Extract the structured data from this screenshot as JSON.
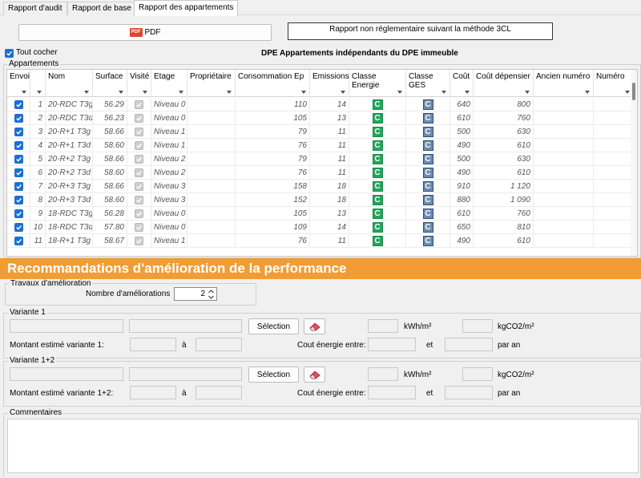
{
  "tabs": [
    {
      "label": "Rapport d'audit",
      "active": false
    },
    {
      "label": "Rapport de base",
      "active": false
    },
    {
      "label": "Rapport des appartements",
      "active": true
    }
  ],
  "toolbar": {
    "pdf_icon_text": "PDF",
    "pdf_label": "PDF",
    "report_button_label": "Rapport non réglementaire suivant la méthode 3CL"
  },
  "select_all_label": "Tout cocher",
  "select_all_checked": true,
  "section_title": "DPE Appartements indépendants du DPE immeuble",
  "table": {
    "group_label": "Appartements",
    "columns": [
      "Envoi",
      "",
      "Nom",
      "Surface",
      "Visité",
      "Etage",
      "Propriétaire",
      "Consommation Ep",
      "Emissions",
      "Classe Energie",
      "Classe GES",
      "Coût",
      "Coût dépensier",
      "Ancien numéro",
      "Numéro"
    ],
    "rows": [
      {
        "envoi": true,
        "num": "1",
        "nom": "20-RDC T3g",
        "surface": "56.29",
        "visite": true,
        "etage": "Niveau 0",
        "proprietaire": "",
        "conso": "110",
        "emissions": "14",
        "classe_energie": "C",
        "classe_ges": "C",
        "cout": "640",
        "cout_dep": "800",
        "ancien": "",
        "numero": ""
      },
      {
        "envoi": true,
        "num": "2",
        "nom": "20-RDC T3d",
        "surface": "56.23",
        "visite": true,
        "etage": "Niveau 0",
        "proprietaire": "",
        "conso": "105",
        "emissions": "13",
        "classe_energie": "C",
        "classe_ges": "C",
        "cout": "610",
        "cout_dep": "760",
        "ancien": "",
        "numero": ""
      },
      {
        "envoi": true,
        "num": "3",
        "nom": "20-R+1 T3g",
        "surface": "58.66",
        "visite": true,
        "etage": "Niveau 1",
        "proprietaire": "",
        "conso": "79",
        "emissions": "11",
        "classe_energie": "C",
        "classe_ges": "C",
        "cout": "500",
        "cout_dep": "630",
        "ancien": "",
        "numero": ""
      },
      {
        "envoi": true,
        "num": "4",
        "nom": "20-R+1 T3d",
        "surface": "58.60",
        "visite": true,
        "etage": "Niveau 1",
        "proprietaire": "",
        "conso": "76",
        "emissions": "11",
        "classe_energie": "C",
        "classe_ges": "C",
        "cout": "490",
        "cout_dep": "610",
        "ancien": "",
        "numero": ""
      },
      {
        "envoi": true,
        "num": "5",
        "nom": "20-R+2 T3g",
        "surface": "58.66",
        "visite": true,
        "etage": "Niveau 2",
        "proprietaire": "",
        "conso": "79",
        "emissions": "11",
        "classe_energie": "C",
        "classe_ges": "C",
        "cout": "500",
        "cout_dep": "630",
        "ancien": "",
        "numero": ""
      },
      {
        "envoi": true,
        "num": "6",
        "nom": "20-R+2 T3d",
        "surface": "58.60",
        "visite": true,
        "etage": "Niveau 2",
        "proprietaire": "",
        "conso": "76",
        "emissions": "11",
        "classe_energie": "C",
        "classe_ges": "C",
        "cout": "490",
        "cout_dep": "610",
        "ancien": "",
        "numero": ""
      },
      {
        "envoi": true,
        "num": "7",
        "nom": "20-R+3 T3g",
        "surface": "58.66",
        "visite": true,
        "etage": "Niveau 3",
        "proprietaire": "",
        "conso": "158",
        "emissions": "18",
        "classe_energie": "C",
        "classe_ges": "C",
        "cout": "910",
        "cout_dep": "1 120",
        "ancien": "",
        "numero": ""
      },
      {
        "envoi": true,
        "num": "8",
        "nom": "20-R+3 T3d",
        "surface": "58.60",
        "visite": true,
        "etage": "Niveau 3",
        "proprietaire": "",
        "conso": "152",
        "emissions": "18",
        "classe_energie": "C",
        "classe_ges": "C",
        "cout": "880",
        "cout_dep": "1 090",
        "ancien": "",
        "numero": ""
      },
      {
        "envoi": true,
        "num": "9",
        "nom": "18-RDC T3g",
        "surface": "56.28",
        "visite": true,
        "etage": "Niveau 0",
        "proprietaire": "",
        "conso": "105",
        "emissions": "13",
        "classe_energie": "C",
        "classe_ges": "C",
        "cout": "610",
        "cout_dep": "760",
        "ancien": "",
        "numero": ""
      },
      {
        "envoi": true,
        "num": "10",
        "nom": "18-RDC T3d",
        "surface": "57.80",
        "visite": true,
        "etage": "Niveau 0",
        "proprietaire": "",
        "conso": "109",
        "emissions": "14",
        "classe_energie": "C",
        "classe_ges": "C",
        "cout": "650",
        "cout_dep": "810",
        "ancien": "",
        "numero": ""
      },
      {
        "envoi": true,
        "num": "11",
        "nom": "18-R+1 T3g",
        "surface": "58.67",
        "visite": true,
        "etage": "Niveau 1",
        "proprietaire": "",
        "conso": "76",
        "emissions": "11",
        "classe_energie": "C",
        "classe_ges": "C",
        "cout": "490",
        "cout_dep": "610",
        "ancien": "",
        "numero": ""
      }
    ]
  },
  "recommendations": {
    "title": "Recommandations d'amélioration de la performance",
    "travaux_label": "Travaux d'amélioration",
    "nb_label": "Nombre d'améliorations",
    "nb_value": "2"
  },
  "variants": [
    {
      "title": "Variante 1",
      "selection_label": "Sélection",
      "kwh_unit": "kWh/m²",
      "co2_unit": "kgCO2/m²",
      "montant_label": "Montant estimé variante 1:",
      "a_label": "à",
      "cout_label": "Cout énergie entre:",
      "et_label": "et",
      "par_an_label": "par an"
    },
    {
      "title": "Variante 1+2",
      "selection_label": "Sélection",
      "kwh_unit": "kWh/m²",
      "co2_unit": "kgCO2/m²",
      "montant_label": "Montant estimé variante 1+2:",
      "a_label": "à",
      "cout_label": "Cout énergie entre:",
      "et_label": "et",
      "par_an_label": "par an"
    }
  ],
  "comments": {
    "title": "Commentaires",
    "value": ""
  },
  "colors": {
    "accent_orange": "#f39c34",
    "energy_green": "#23a55c",
    "ges_blue": "#6b8bb1",
    "check_blue": "#1d6fd1"
  }
}
